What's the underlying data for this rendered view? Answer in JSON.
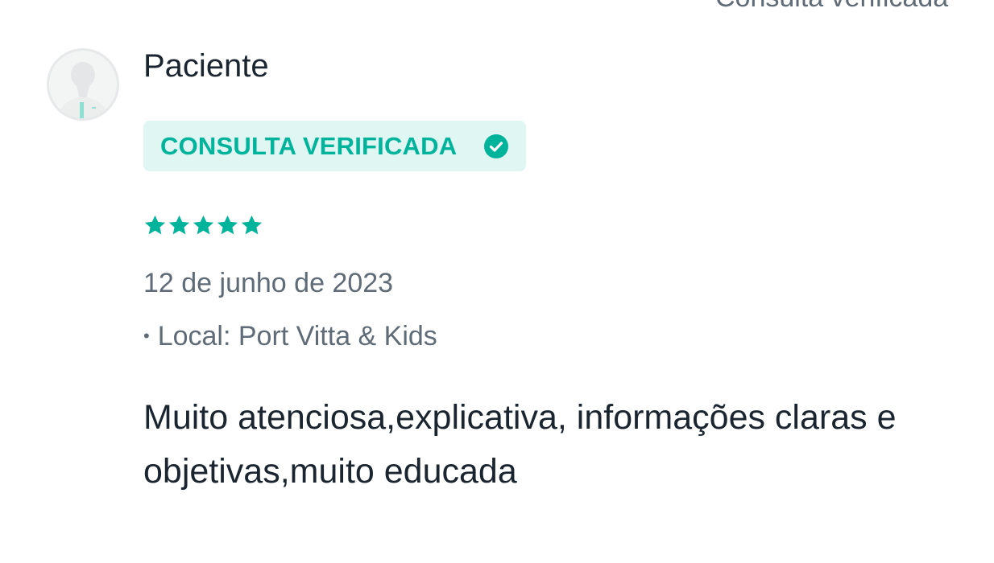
{
  "header": {
    "cutoff_text": "Consulta verificada"
  },
  "review": {
    "author": "Paciente",
    "badge_label": "CONSULTA VERIFICADA",
    "rating": 5,
    "rating_max": 5,
    "date": "12 de junho de 2023",
    "location_bullet": "•",
    "location": "Local: Port Vitta & Kids",
    "text": "Muito atenciosa,explicativa, informações claras e objetivas,muito educada"
  },
  "colors": {
    "accent": "#00b39b",
    "badge_bg": "#dff6f2",
    "text_primary": "#1a2530",
    "text_secondary": "#5f6b76"
  },
  "icons": {
    "avatar": "doctor-avatar-icon",
    "badge": "check-circle-icon",
    "star": "star-icon"
  }
}
